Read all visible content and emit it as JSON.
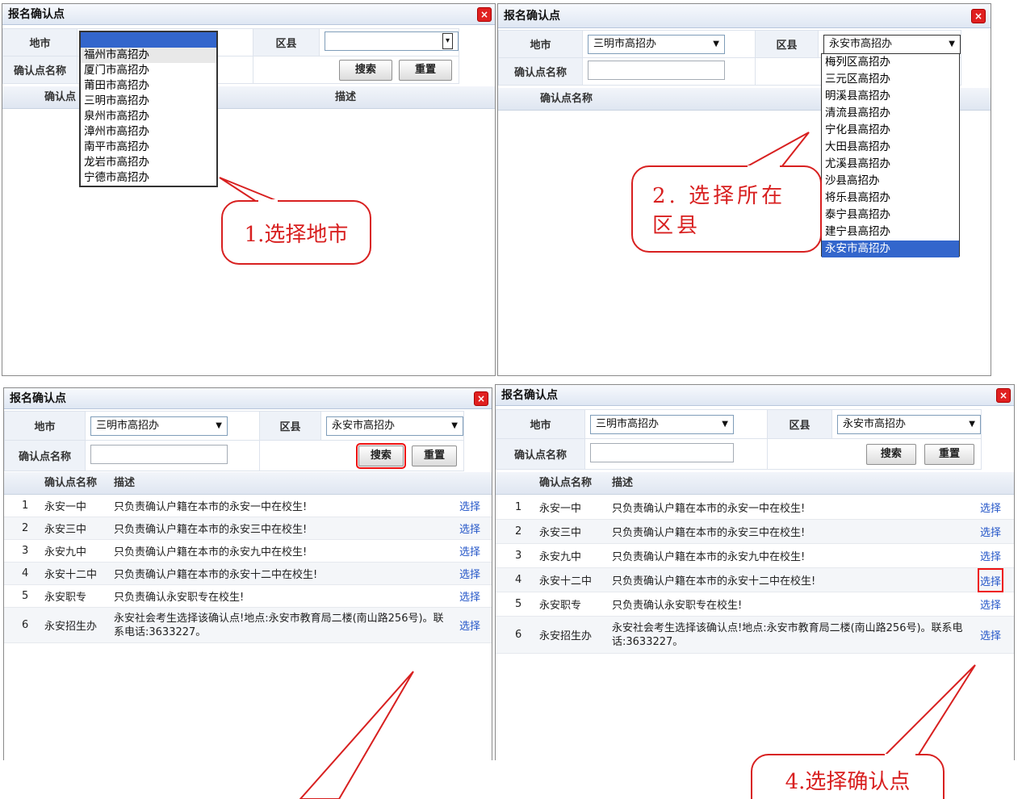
{
  "panel_title": "报名确认点",
  "close_glyph": "×",
  "labels": {
    "city": "地市",
    "district": "区县",
    "point_name": "确认点名称",
    "description": "描述"
  },
  "buttons": {
    "search": "搜索",
    "reset": "重置",
    "reset_partial": "置"
  },
  "panel1": {
    "city_dropdown": [
      "福州市高招办",
      "厦门市高招办",
      "莆田市高招办",
      "三明市高招办",
      "泉州市高招办",
      "漳州市高招办",
      "南平市高招办",
      "龙岩市高招办",
      "宁德市高招办"
    ],
    "grid_head_partial": "确认点"
  },
  "panel2": {
    "city_value": "三明市高招办",
    "district_value": "永安市高招办",
    "district_dropdown": [
      "梅列区高招办",
      "三元区高招办",
      "明溪县高招办",
      "清流县高招办",
      "宁化县高招办",
      "大田县高招办",
      "尤溪县高招办",
      "沙县高招办",
      "将乐县高招办",
      "泰宁县高招办",
      "建宁县高招办",
      "永安市高招办"
    ]
  },
  "panel3": {
    "city_value": "三明市高招办",
    "district_value": "永安市高招办"
  },
  "panel4": {
    "city_value": "三明市高招办",
    "district_value": "永安市高招办"
  },
  "results": [
    {
      "no": "1",
      "name": "永安一中",
      "desc": "只负责确认户籍在本市的永安一中在校生!",
      "action": "选择"
    },
    {
      "no": "2",
      "name": "永安三中",
      "desc": "只负责确认户籍在本市的永安三中在校生!",
      "action": "选择"
    },
    {
      "no": "3",
      "name": "永安九中",
      "desc": "只负责确认户籍在本市的永安九中在校生!",
      "action": "选择"
    },
    {
      "no": "4",
      "name": "永安十二中",
      "desc": "只负责确认户籍在本市的永安十二中在校生!",
      "action": "选择"
    },
    {
      "no": "5",
      "name": "永安职专",
      "desc": "只负责确认永安职专在校生!",
      "action": "选择"
    },
    {
      "no": "6",
      "name": "永安招生办",
      "desc": "永安社会考生选择该确认点!地点:永安市教育局二楼(南山路256号)。联系电话:3633227。",
      "action": "选择"
    }
  ],
  "callouts": {
    "step1": "1.选择地市",
    "step2": "2. 选择所在区县",
    "step4": "4.选择确认点"
  },
  "colors": {
    "accent_red": "#d82020",
    "link_blue": "#2456c8",
    "header_blue": "#dfe7f3"
  }
}
